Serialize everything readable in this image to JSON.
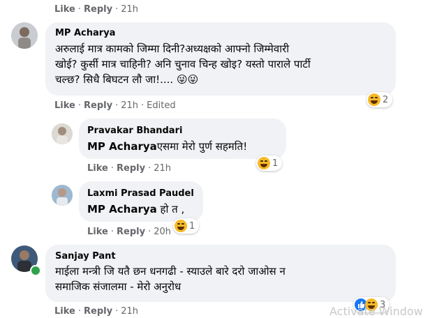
{
  "top_actions": {
    "like": "Like",
    "reply": "Reply",
    "time": "21h"
  },
  "comments": [
    {
      "author": "MP Acharya",
      "lines": [
        "अरुलाई मात्र कामको जिम्मा दिनी?अध्यक्षको आफ्नो जिम्मेवारी",
        "खोई? कुर्सी मात्र चाहिनी? अनि चुनाव चिन्ह खोइ? यस्तो पाराले पार्टी",
        "चल्छ? सिधै बिघटन लौ जा!.... 😜😜"
      ],
      "actions": {
        "like": "Like",
        "reply": "Reply",
        "time": "21h",
        "edited": "Edited"
      },
      "reaction": {
        "icon": "laughing-emoji-icon",
        "count": "2"
      }
    },
    {
      "author": "Pravakar Bhandari",
      "mention": "MP Acharya",
      "text": "एसमा मेरो पुर्ण सहमति!",
      "actions": {
        "like": "Like",
        "reply": "Reply",
        "time": "21h"
      },
      "reaction": {
        "icon": "laughing-emoji-icon",
        "count": "1"
      }
    },
    {
      "author": "Laxmi Prasad Paudel",
      "mention": "MP Acharya",
      "text": " हो त ,",
      "actions": {
        "like": "Like",
        "reply": "Reply",
        "time": "20h"
      },
      "reaction": {
        "icon": "laughing-emoji-icon",
        "count": "1"
      }
    },
    {
      "author": "Sanjay Pant",
      "lines": [
        "माईला मन्त्री जि यतै छन धनगढी - स्याउले बारे दरो जाओस न",
        "समाजिक संजालमा - मेरो अनुरोध"
      ],
      "actions": {
        "like": "Like",
        "reply": "Reply",
        "time": "21h"
      },
      "reaction": {
        "icons": [
          "like-icon",
          "laughing-emoji-icon"
        ],
        "count": "3"
      }
    }
  ],
  "watermark": "Activate Window",
  "colors": {
    "bubble": "#f0f2f5",
    "meta": "#65676b",
    "online": "#31a24c",
    "like_blue": "#1877f2",
    "laugh_yellow": "#f7b928"
  }
}
